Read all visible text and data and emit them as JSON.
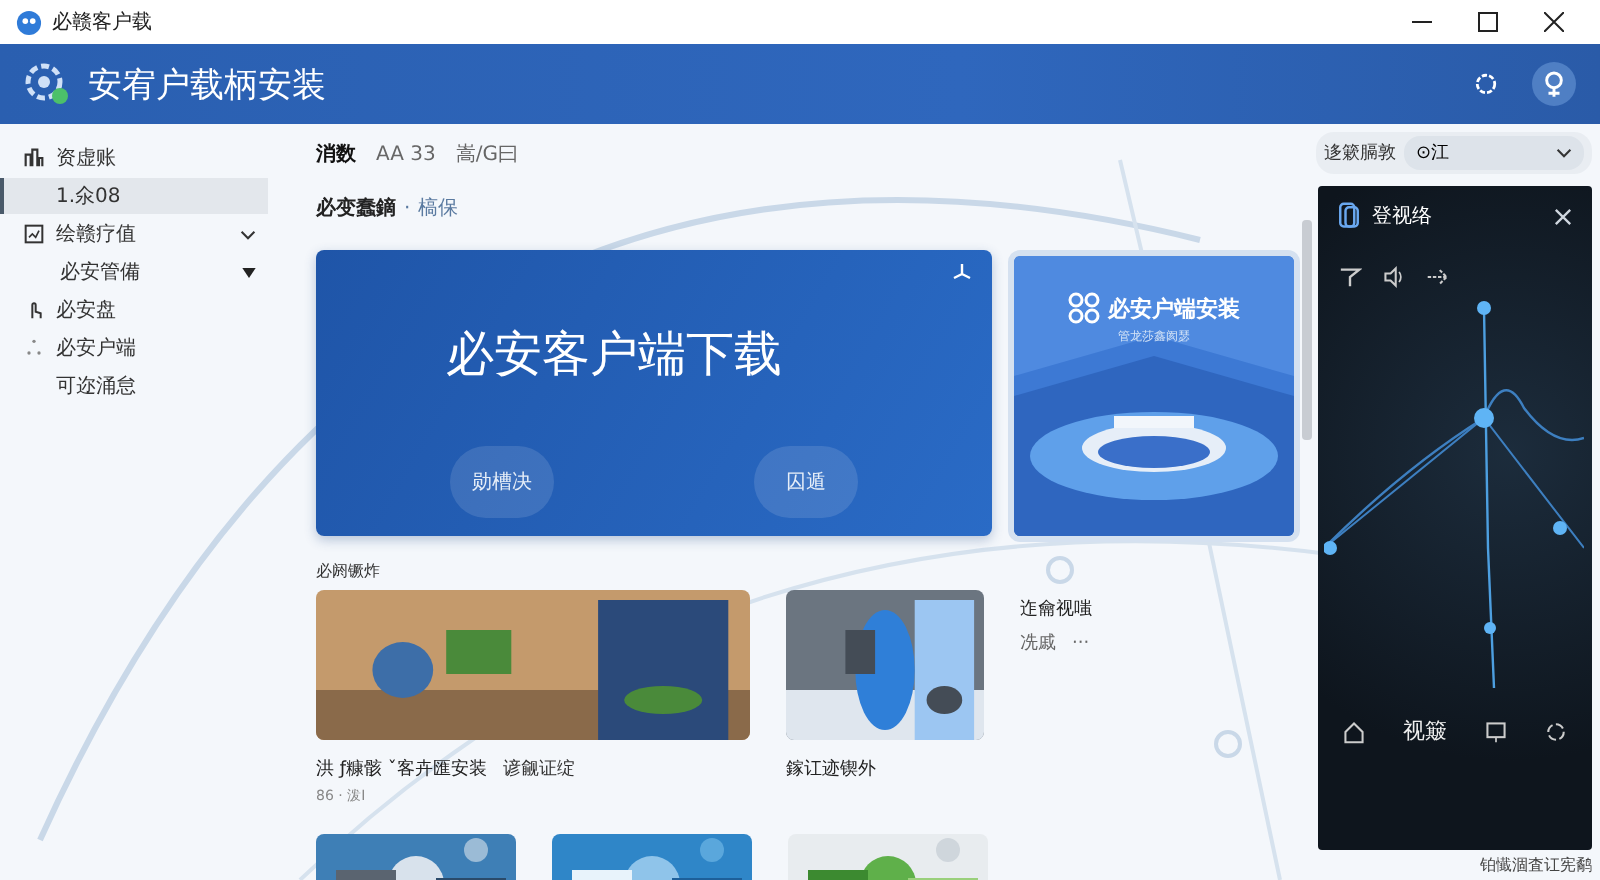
{
  "window": {
    "title": "必赣客户载"
  },
  "header": {
    "title": "安宥户载柄安装"
  },
  "sidebar": {
    "items": [
      {
        "label": "资虚账",
        "selected": false
      },
      {
        "label": "1.氽08",
        "selected": true
      },
      {
        "label": "绘赣疗值",
        "selected": false,
        "expanded": true,
        "children": [
          {
            "label": "必安管備",
            "selected": false
          }
        ]
      },
      {
        "label": "必安盘",
        "selected": false
      },
      {
        "label": "必安户端",
        "selected": false
      },
      {
        "label": "可迩涌怠",
        "selected": false
      }
    ]
  },
  "tabs": [
    {
      "label": "消数",
      "selected": true
    },
    {
      "label": "AA 33",
      "selected": false
    },
    {
      "label": "嵩/G曰",
      "selected": false
    }
  ],
  "subheading": {
    "title": "必变蠢鏑",
    "separator": "·",
    "link": "槁保"
  },
  "hero": {
    "title": "必安客户端下载",
    "buttons": [
      "勋槽决",
      "囚遁"
    ]
  },
  "promo": {
    "title": "必安户端安装",
    "subtitle": "管龙莎鑫阂瑟"
  },
  "filter": {
    "label": "迻簌膈敦",
    "value": "⊙江"
  },
  "section": {
    "title": "必阏镢炸"
  },
  "cards": [
    {
      "caption": "洪 ƒ糠骸 ˇ客卉匯安装",
      "meta": "86 · 泼I",
      "badge": "谚觎证绽"
    },
    {
      "caption": "鎵讧迹锲外"
    }
  ],
  "side_note": {
    "title": "迮龠视嗤",
    "meta": "冼戚",
    "more": "···"
  },
  "panel": {
    "title": "登视络",
    "nav": [
      {
        "kind": "home"
      },
      {
        "kind": "label",
        "label": "视簸"
      },
      {
        "kind": "screen"
      },
      {
        "kind": "refresh"
      }
    ],
    "footer": "铂懴涸査讧宪鹬"
  }
}
